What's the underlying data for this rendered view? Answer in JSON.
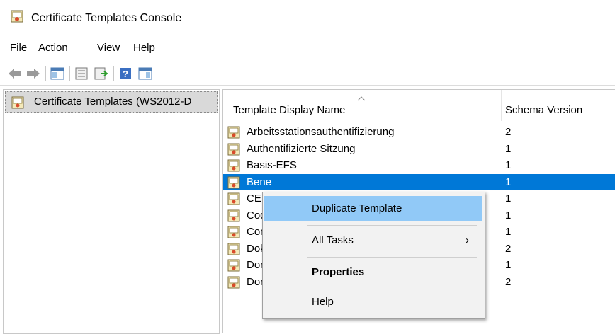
{
  "window": {
    "title": "Certificate Templates Console"
  },
  "menu": [
    "File",
    "Action",
    "View",
    "Help"
  ],
  "toolbar": {
    "icons": [
      "back-arrow-icon",
      "forward-arrow-icon",
      "show-hide-tree-icon",
      "properties-icon",
      "export-list-icon",
      "help-icon",
      "show-hide-action-pane-icon"
    ]
  },
  "tree": {
    "root_label": "Certificate Templates (WS2012-D"
  },
  "list": {
    "columns": [
      "Template Display Name",
      "Schema Version"
    ],
    "rows": [
      {
        "name": "Arbeitsstationsauthentifizierung",
        "version": "2"
      },
      {
        "name": "Authentifizierte Sitzung",
        "version": "1"
      },
      {
        "name": "Basis-EFS",
        "version": "1"
      },
      {
        "name": "Bene",
        "version": "1"
      },
      {
        "name": "CEP",
        "version": "1"
      },
      {
        "name": "Cod",
        "version": "1"
      },
      {
        "name": "Com",
        "version": "1"
      },
      {
        "name": "Dok",
        "version": "2"
      },
      {
        "name": "Dom",
        "version": "1"
      },
      {
        "name": "Domänencontrollerauthentifizierung",
        "version": "2"
      }
    ],
    "selected_row_index": 3
  },
  "context_menu": {
    "duplicate": "Duplicate Template",
    "all_tasks": "All Tasks",
    "properties": "Properties",
    "help": "Help"
  },
  "colors": {
    "selection": "#0078d7",
    "menu_hover": "#91c9f7"
  }
}
